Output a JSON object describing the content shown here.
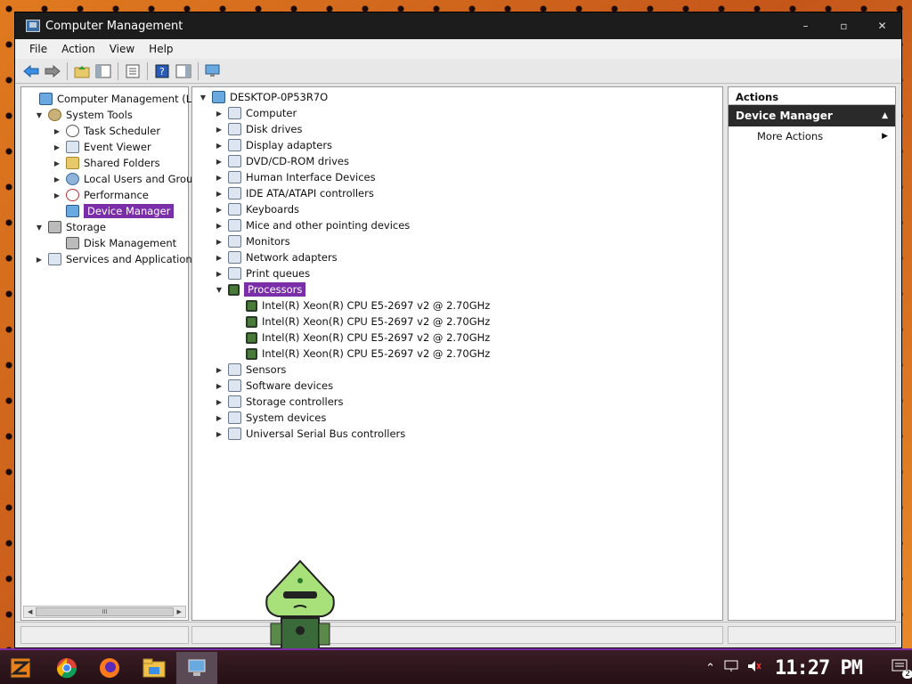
{
  "window": {
    "title": "Computer Management",
    "controls": {
      "minimize": "–",
      "maximize": "▫",
      "close": "✕"
    }
  },
  "menu": [
    "File",
    "Action",
    "View",
    "Help"
  ],
  "left_tree": [
    {
      "label": "Computer Management (Local)",
      "icon": "computer-management-icon",
      "expander": "",
      "level": 0
    },
    {
      "label": "System Tools",
      "icon": "tools-icon",
      "expander": "▼",
      "level": 1
    },
    {
      "label": "Task Scheduler",
      "icon": "clock-icon",
      "expander": "▶",
      "level": 2
    },
    {
      "label": "Event Viewer",
      "icon": "event-viewer-icon",
      "expander": "▶",
      "level": 2
    },
    {
      "label": "Shared Folders",
      "icon": "folder-icon",
      "expander": "▶",
      "level": 2
    },
    {
      "label": "Local Users and Groups",
      "icon": "users-icon",
      "expander": "▶",
      "level": 2
    },
    {
      "label": "Performance",
      "icon": "performance-icon",
      "expander": "▶",
      "level": 2
    },
    {
      "label": "Device Manager",
      "icon": "device-manager-icon",
      "expander": "",
      "level": 2,
      "selected": true
    },
    {
      "label": "Storage",
      "icon": "storage-icon",
      "expander": "▼",
      "level": 1
    },
    {
      "label": "Disk Management",
      "icon": "disk-icon",
      "expander": "",
      "level": 2
    },
    {
      "label": "Services and Applications",
      "icon": "services-icon",
      "expander": "▶",
      "level": 1
    }
  ],
  "scrollbar": {
    "left": "◀",
    "thumb": "III",
    "right": "▶"
  },
  "device_tree": {
    "root": "DESKTOP-0P53R7O",
    "root_expander": "▼",
    "categories": [
      {
        "label": "Computer",
        "icon": "computer-icon",
        "expander": "▶"
      },
      {
        "label": "Disk drives",
        "icon": "disk-drive-icon",
        "expander": "▶"
      },
      {
        "label": "Display adapters",
        "icon": "display-adapter-icon",
        "expander": "▶"
      },
      {
        "label": "DVD/CD-ROM drives",
        "icon": "dvd-icon",
        "expander": "▶"
      },
      {
        "label": "Human Interface Devices",
        "icon": "hid-icon",
        "expander": "▶"
      },
      {
        "label": "IDE ATA/ATAPI controllers",
        "icon": "ide-icon",
        "expander": "▶"
      },
      {
        "label": "Keyboards",
        "icon": "keyboard-icon",
        "expander": "▶"
      },
      {
        "label": "Mice and other pointing devices",
        "icon": "mouse-icon",
        "expander": "▶"
      },
      {
        "label": "Monitors",
        "icon": "monitor-icon",
        "expander": "▶"
      },
      {
        "label": "Network adapters",
        "icon": "network-icon",
        "expander": "▶"
      },
      {
        "label": "Print queues",
        "icon": "printer-icon",
        "expander": "▶"
      },
      {
        "label": "Processors",
        "icon": "processor-icon",
        "expander": "▼",
        "selected": true,
        "children": [
          "Intel(R) Xeon(R) CPU E5-2697 v2 @ 2.70GHz",
          "Intel(R) Xeon(R) CPU E5-2697 v2 @ 2.70GHz",
          "Intel(R) Xeon(R) CPU E5-2697 v2 @ 2.70GHz",
          "Intel(R) Xeon(R) CPU E5-2697 v2 @ 2.70GHz"
        ]
      },
      {
        "label": "Sensors",
        "icon": "sensor-icon",
        "expander": "▶"
      },
      {
        "label": "Software devices",
        "icon": "software-device-icon",
        "expander": "▶"
      },
      {
        "label": "Storage controllers",
        "icon": "storage-controller-icon",
        "expander": "▶"
      },
      {
        "label": "System devices",
        "icon": "system-device-icon",
        "expander": "▶"
      },
      {
        "label": "Universal Serial Bus controllers",
        "icon": "usb-icon",
        "expander": "▶"
      }
    ]
  },
  "actions": {
    "header": "Actions",
    "group": "Device Manager",
    "group_arrow": "▲",
    "items": [
      {
        "label": "More Actions",
        "arrow": "▶"
      }
    ]
  },
  "taskbar": {
    "clock": "11:27 PM",
    "notification_count": "2",
    "apps": [
      "start-icon",
      "chrome-icon",
      "firefox-icon",
      "file-explorer-icon",
      "computer-management-taskbar-icon"
    ]
  },
  "colors": {
    "selection": "#7a2fa8",
    "titlebar": "#1c1c1c",
    "accent": "#7a2fa8"
  }
}
